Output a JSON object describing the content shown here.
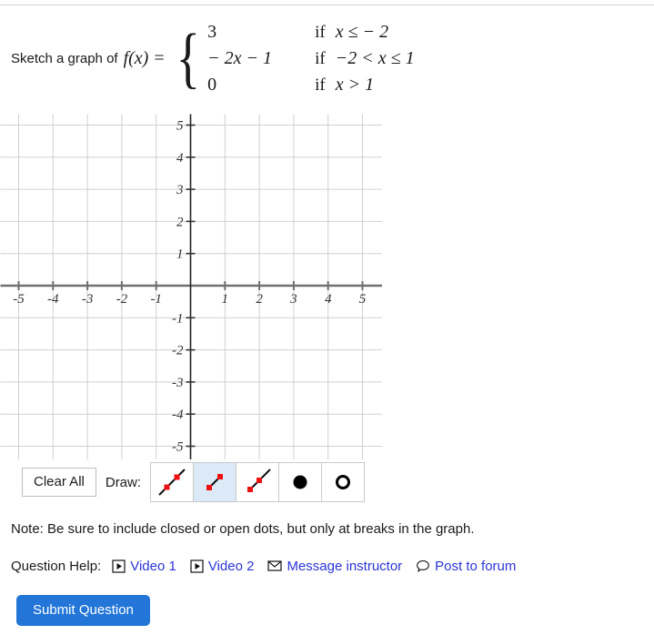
{
  "prompt": {
    "lead": "Sketch a graph of",
    "fn": "f(x)",
    "equals": "=",
    "cases": [
      {
        "value": "3",
        "if": "if",
        "cond": "x ≤ − 2"
      },
      {
        "value": "− 2x − 1",
        "if": "if",
        "cond": "−2 < x ≤ 1"
      },
      {
        "value": "0",
        "if": "if",
        "cond": "x > 1"
      }
    ]
  },
  "graph": {
    "x_ticks": [
      "-5",
      "-4",
      "-3",
      "-2",
      "-1",
      "1",
      "2",
      "3",
      "4",
      "5"
    ],
    "y_ticks": [
      "5",
      "4",
      "3",
      "2",
      "1",
      "-1",
      "-2",
      "-3",
      "-4",
      "-5"
    ],
    "xlim": [
      -5,
      5
    ],
    "ylim": [
      -5,
      5
    ],
    "grid": true,
    "grid_color": "#d0d0d0",
    "axis_color": "#707070",
    "plotted_points": []
  },
  "chart_data": {
    "type": "line",
    "title": "",
    "xlabel": "",
    "ylabel": "",
    "xlim": [
      -5,
      5
    ],
    "ylim": [
      -5,
      5
    ],
    "x_ticks": [
      -5,
      -4,
      -3,
      -2,
      -1,
      1,
      2,
      3,
      4,
      5
    ],
    "y_ticks": [
      5,
      4,
      3,
      2,
      1,
      -1,
      -2,
      -3,
      -4,
      -5
    ],
    "grid": true,
    "legend": "none",
    "series": []
  },
  "toolbar": {
    "clear_label": "Clear All",
    "draw_label": "Draw:",
    "tools": [
      {
        "name": "line-tool",
        "icon": "line-icon",
        "selected": false
      },
      {
        "name": "segment-tool",
        "icon": "segment-icon",
        "selected": true
      },
      {
        "name": "ray-tool",
        "icon": "ray-icon",
        "selected": false
      },
      {
        "name": "closed-dot-tool",
        "icon": "closed-dot-icon",
        "selected": false
      },
      {
        "name": "open-dot-tool",
        "icon": "open-dot-icon",
        "selected": false
      }
    ]
  },
  "note": "Note: Be sure to include closed or open dots, but only at breaks in the graph.",
  "help": {
    "label": "Question Help:",
    "items": [
      {
        "icon": "play-icon",
        "label": "Video 1"
      },
      {
        "icon": "play-icon",
        "label": "Video 2"
      },
      {
        "icon": "envelope-icon",
        "label": "Message instructor"
      },
      {
        "icon": "speech-bubble-icon",
        "label": "Post to forum"
      }
    ]
  },
  "submit": {
    "label": "Submit Question"
  },
  "colors": {
    "link": "#2b35d6",
    "submit_bg": "#2376d8",
    "selected_tool_bg": "#dce9f7",
    "point_red": "#ee1111"
  }
}
